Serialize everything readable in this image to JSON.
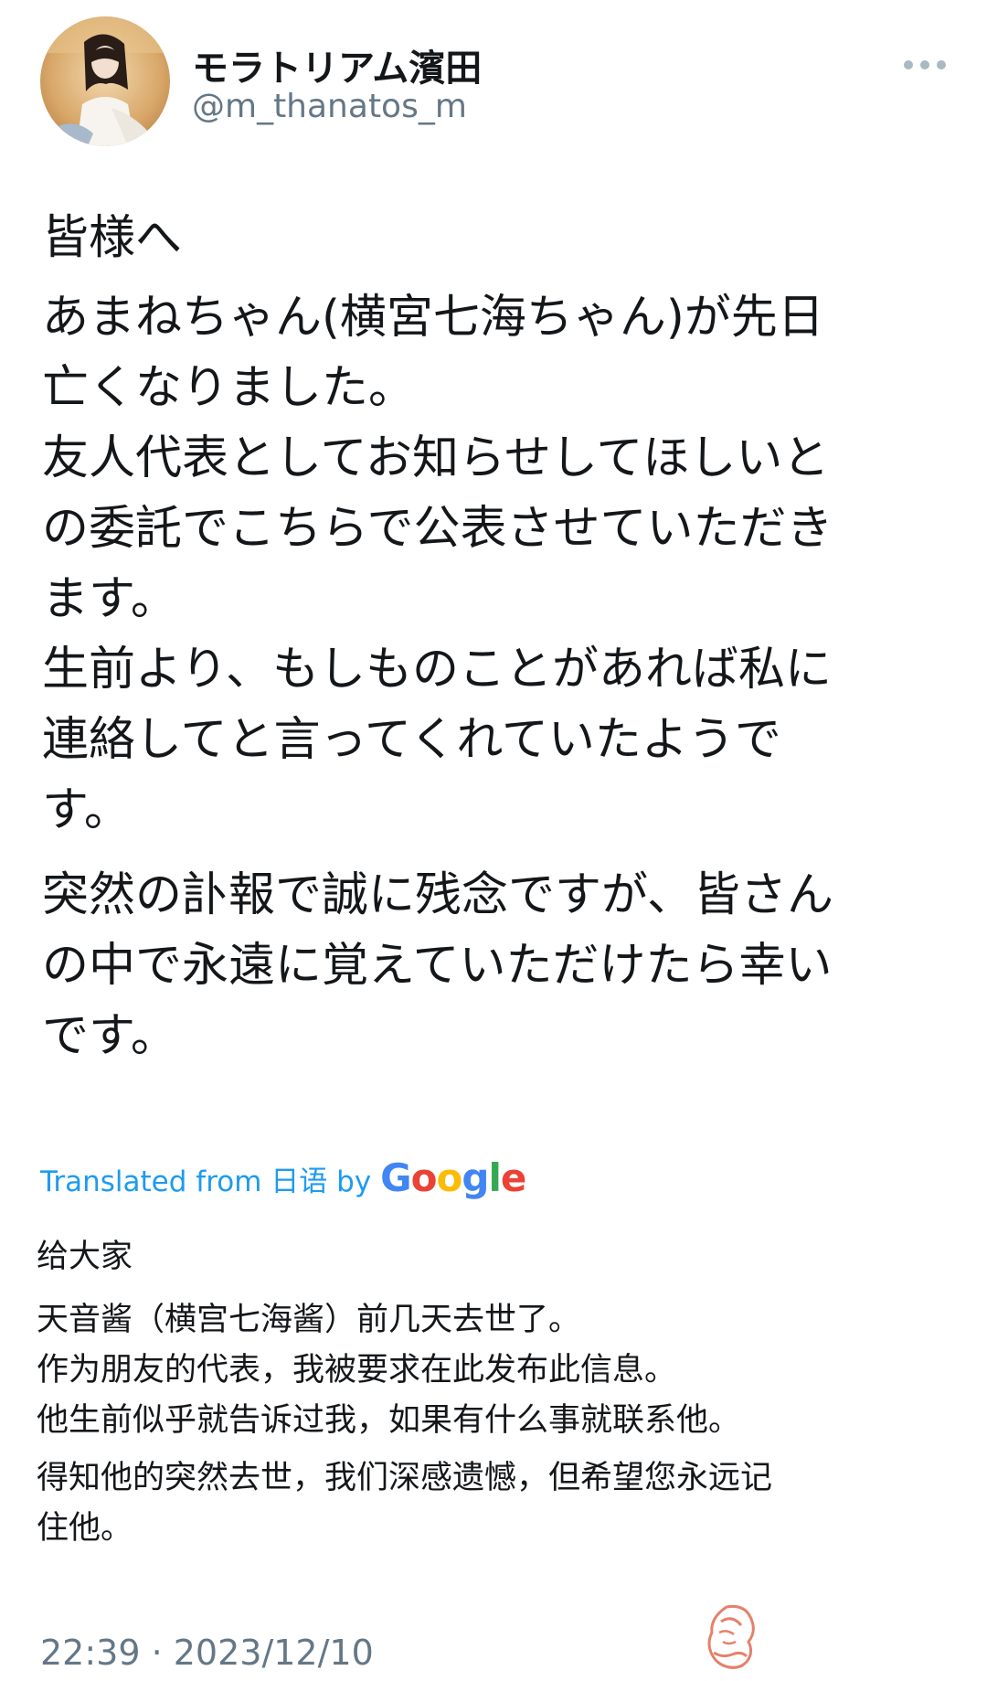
{
  "user": {
    "display_name": "モラトリアム濱田",
    "handle": "@m_thanatos_m",
    "avatar_icon": "user-photo-avatar"
  },
  "menu": {
    "more_icon": "more-horizontal-icon"
  },
  "tweet": {
    "original_paragraphs": [
      [
        "皆様へ"
      ],
      [
        "あまねちゃん(横宮七海ちゃん)が先日",
        "亡くなりました。",
        "友人代表としてお知らせしてほしいと",
        "の委託でこちらで公表させていただき",
        "ます。",
        "生前より、もしものことがあれば私に",
        "連絡してと言ってくれていたようで",
        "す。"
      ],
      [
        "突然の訃報で誠に残念ですが、皆さん",
        "の中で永遠に覚えていただけたら幸い",
        "です。"
      ]
    ],
    "translation_label_prefix": "Translated from 日语 by",
    "translation_brand": [
      "G",
      "o",
      "o",
      "g",
      "l",
      "e"
    ],
    "translated_paragraphs": [
      [
        "给大家"
      ],
      [
        "天音酱（横宫七海酱）前几天去世了。",
        "作为朋友的代表，我被要求在此发布此信息。",
        "他生前似乎就告诉过我，如果有什么事就联系他。"
      ],
      [
        "得知他的突然去世，我们深感遗憾，但希望您永远记",
        "住他。"
      ]
    ],
    "timestamp": "22:39 · 2023/12/10"
  },
  "colors": {
    "link_blue": "#1d9bf0",
    "muted_gray": "#657786",
    "text": "#14171a",
    "watermark": "#e4735a"
  },
  "watermark_icon": "woman-silhouette-watermark-icon"
}
